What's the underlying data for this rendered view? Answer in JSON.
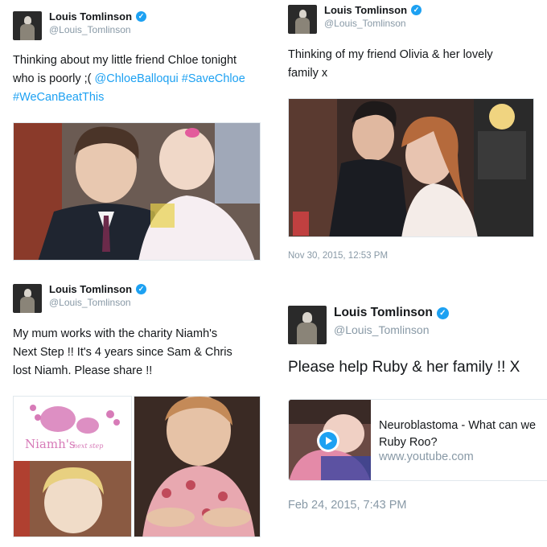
{
  "tweets": [
    {
      "name": "Louis Tomlinson",
      "handle": "@Louis_Tomlinson",
      "text_lines": [
        [
          {
            "t": "Thinking about my little friend Chloe tonight",
            "link": false
          }
        ],
        [
          {
            "t": "who is poorly ;( ",
            "link": false
          },
          {
            "t": "@ChloeBalloqui",
            "link": true
          },
          {
            "t": " ",
            "link": false
          },
          {
            "t": "#SaveChloe",
            "link": true
          }
        ],
        [
          {
            "t": "#WeCanBeatThis",
            "link": true
          }
        ]
      ]
    },
    {
      "name": "Louis Tomlinson",
      "handle": "@Louis_Tomlinson",
      "text_lines": [
        [
          {
            "t": "Thinking of my friend Olivia & her lovely",
            "link": false
          }
        ],
        [
          {
            "t": "family x",
            "link": false
          }
        ]
      ],
      "timestamp": "Nov 30, 2015, 12:53 PM"
    },
    {
      "name": "Louis Tomlinson",
      "handle": "@Louis_Tomlinson",
      "text_lines": [
        [
          {
            "t": "My mum works with the charity Niamh's",
            "link": false
          }
        ],
        [
          {
            "t": "Next Step !! It's 4 years since Sam & Chris",
            "link": false
          }
        ],
        [
          {
            "t": "lost Niamh. Please share !!",
            "link": false
          }
        ]
      ],
      "media_logo_text": "Niamh's",
      "media_logo_subtext": "next step"
    },
    {
      "name": "Louis Tomlinson",
      "handle": "@Louis_Tomlinson",
      "text_lines": [
        [
          {
            "t": "Please help Ruby & her family !! X",
            "link": false
          }
        ]
      ],
      "card": {
        "title_lines": [
          "Neuroblastoma - What can we",
          "Ruby Roo?"
        ],
        "domain": "www.youtube.com",
        "play_icon": "play-icon"
      },
      "timestamp": "Feb 24, 2015, 7:43 PM"
    }
  ],
  "icons": {
    "verified": "verified-badge-icon",
    "verified_glyph": "✓"
  },
  "colors": {
    "link": "#1da1f2",
    "secondary_text": "#8899a6",
    "verified": "#1da1f2",
    "logo_pink": "#d77bb8"
  }
}
